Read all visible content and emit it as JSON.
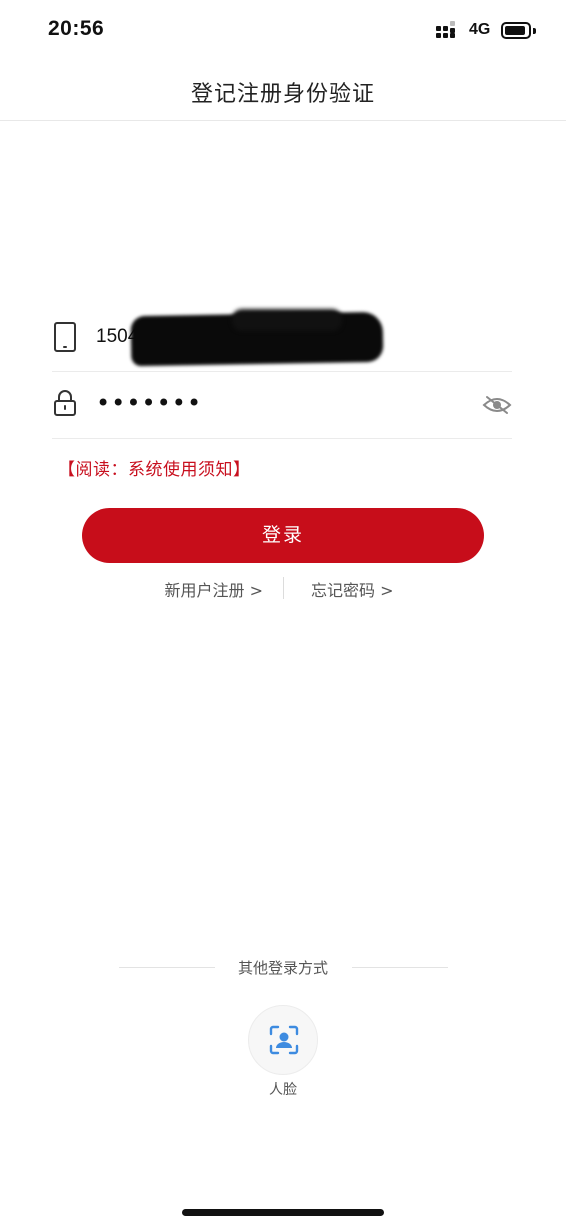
{
  "status_bar": {
    "time": "20:56",
    "network": "4G",
    "icons": [
      "signal-icon",
      "battery-icon"
    ]
  },
  "nav": {
    "title": "登记注册身份验证"
  },
  "form": {
    "phone": {
      "icon": "phone-icon",
      "value": "1504"
    },
    "password": {
      "icon": "lock-icon",
      "value": "•••••••",
      "toggle_icon": "eye-hidden-icon"
    },
    "notice": "【阅读：系统使用须知】",
    "login_label": "登录",
    "register_link": "新用户注册 >",
    "forgot_link": "忘记密码 >"
  },
  "other_login": {
    "title": "其他登录方式",
    "methods": [
      {
        "label": "人脸",
        "icon": "face-scan-icon"
      }
    ]
  },
  "colors": {
    "primary": "#c70d1a",
    "notice": "#c8101f",
    "face_icon": "#3d8be0"
  }
}
